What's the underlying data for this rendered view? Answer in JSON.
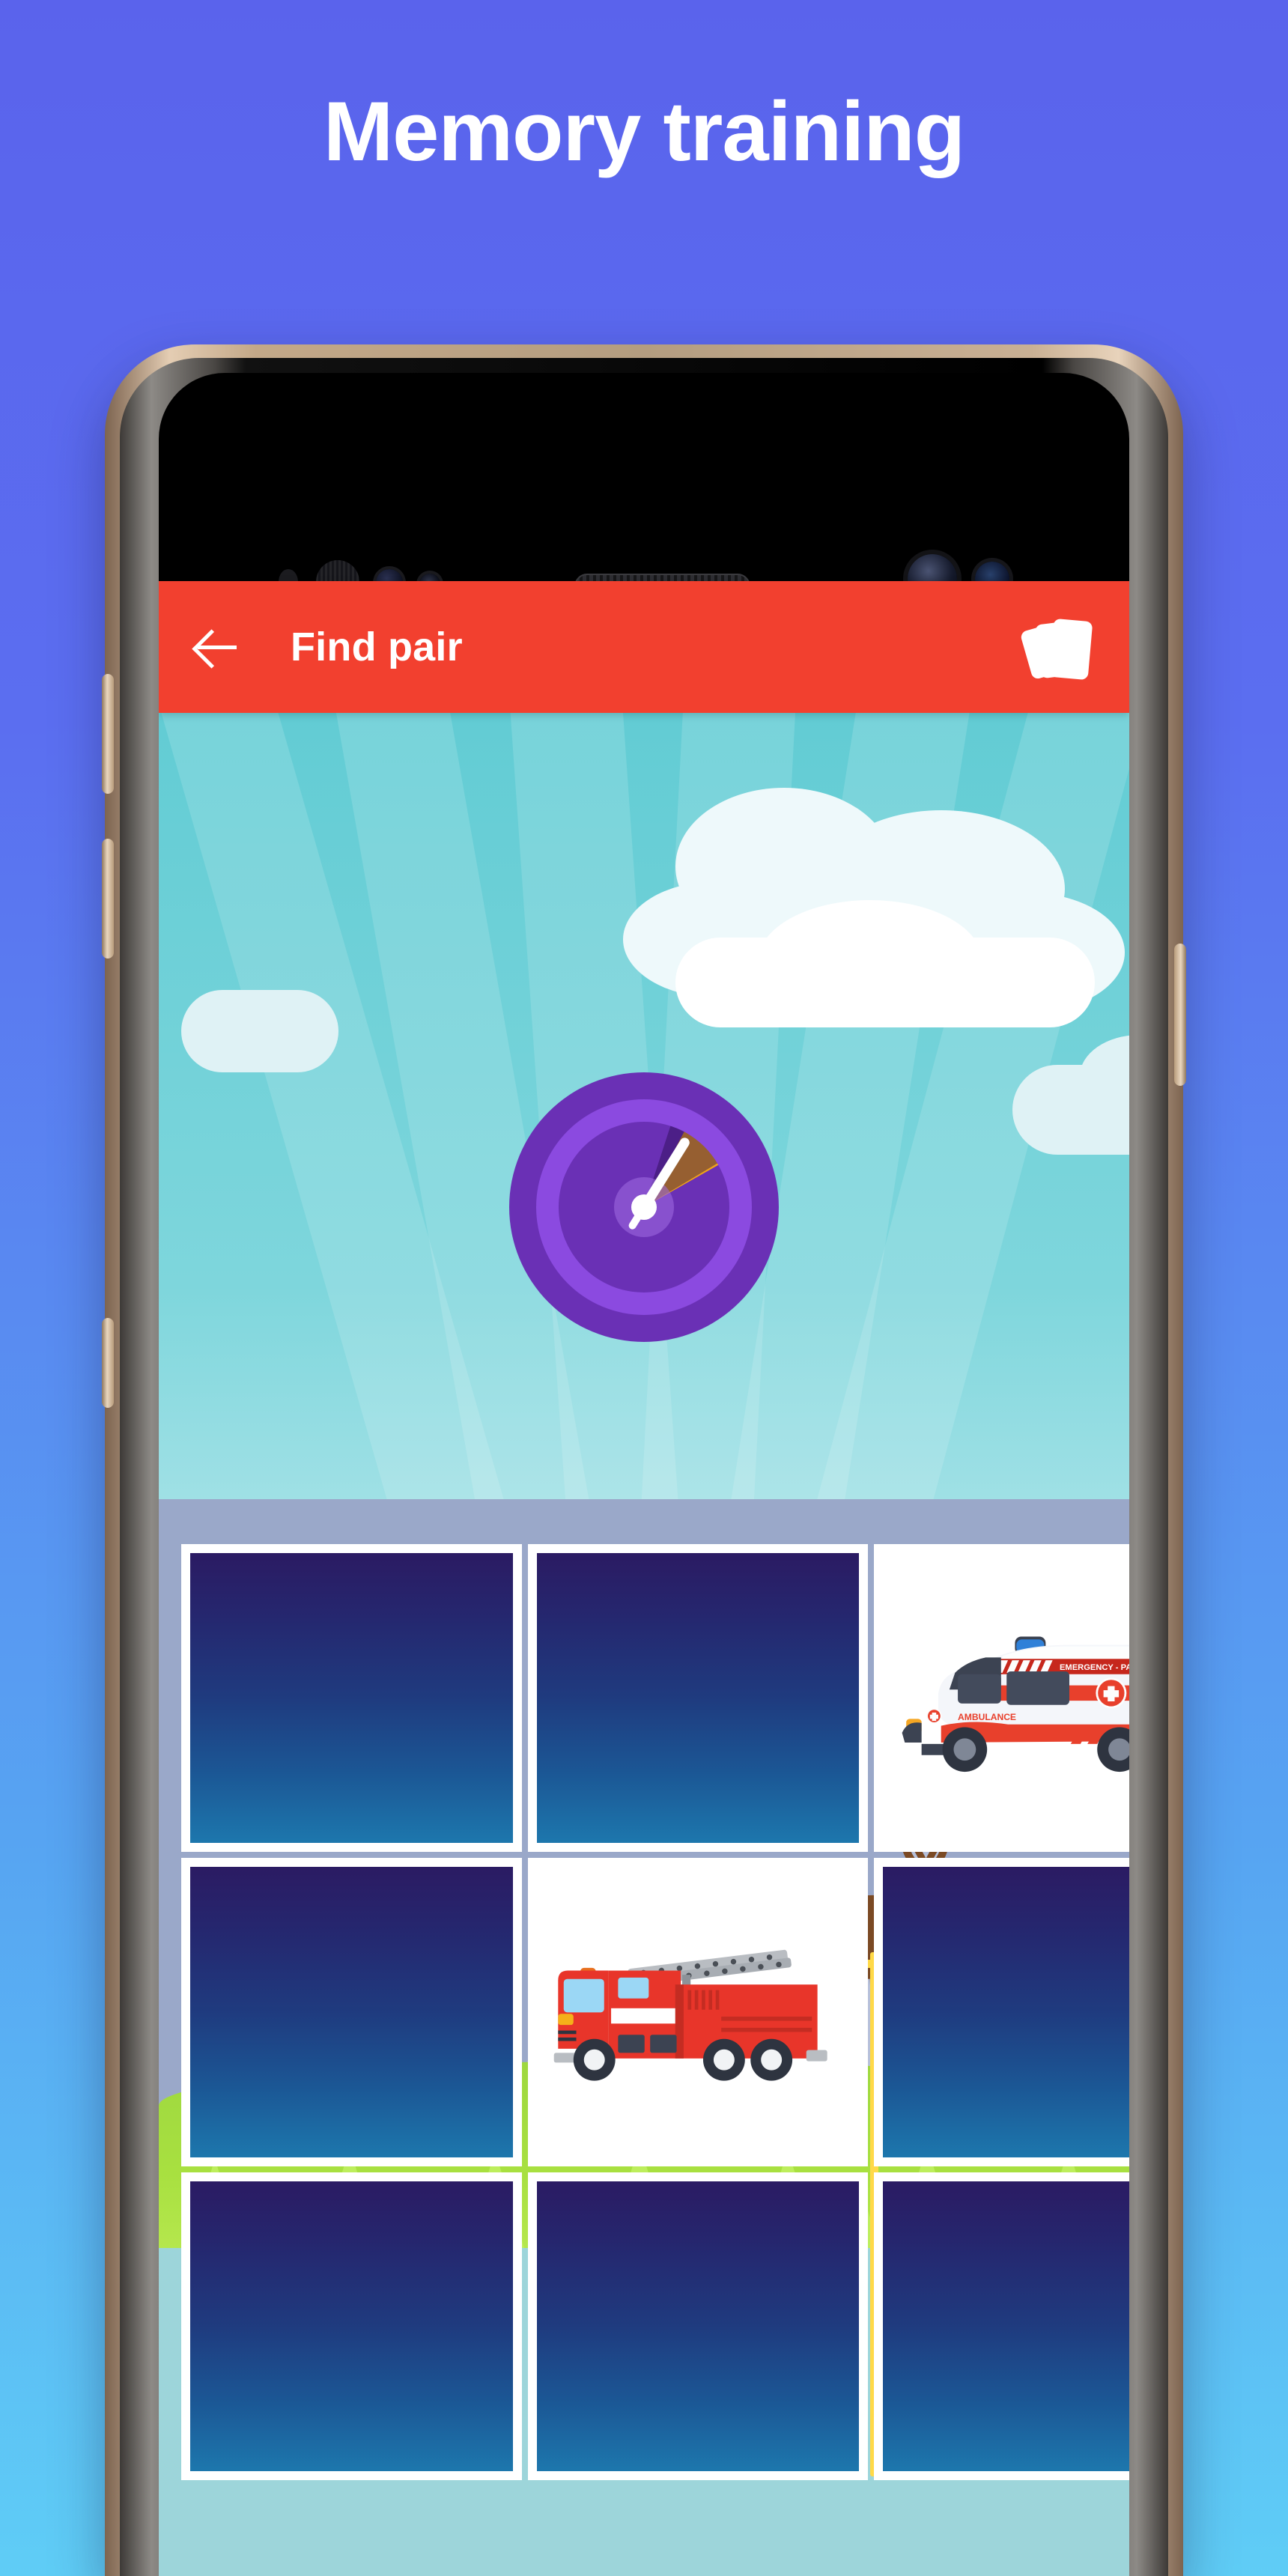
{
  "promo": {
    "title": "Memory training",
    "background_top": "#5a63ec",
    "background_bottom": "#5fcdf6"
  },
  "device": {
    "name": "android-phone-mockup",
    "bezel_color": "#c3a888",
    "screen_bg": "#000000",
    "hardware": {
      "earpiece": "speaker-grille",
      "front_camera": "front-camera",
      "proximity_sensor": "proximity-sensor",
      "iris_scanner": "iris-scanner",
      "volume_up": "volume-up-button",
      "volume_down": "volume-down-button",
      "bixby": "assistant-button",
      "power": "power-button"
    }
  },
  "app": {
    "appbar": {
      "back_label": "back-arrow",
      "title": "Find pair",
      "action_icon": "cards-stack-icon",
      "bg_color": "#f2402f",
      "text_color": "#ffffff"
    },
    "timer": {
      "name": "round-timer-gauge",
      "ring_color": "#8b4ae0",
      "body_color": "#6a30b5",
      "progress_color": "#f0a419",
      "needle_color": "#ffffff",
      "needle_angle_deg": 32,
      "progress_arc_deg": 28
    },
    "board": {
      "rows": 3,
      "columns": 3,
      "card_back_top": "#2b1b63",
      "card_back_bottom": "#1d77ad",
      "highlight_color": "#ffd948",
      "cells": [
        {
          "index": 0,
          "state": "face-down",
          "image": ""
        },
        {
          "index": 1,
          "state": "face-down",
          "image": ""
        },
        {
          "index": 2,
          "state": "face-up",
          "image": "ambulance"
        },
        {
          "index": 3,
          "state": "face-down",
          "image": ""
        },
        {
          "index": 4,
          "state": "face-up",
          "image": "fire-truck"
        },
        {
          "index": 5,
          "state": "face-down",
          "image": ""
        },
        {
          "index": 6,
          "state": "face-down",
          "image": ""
        },
        {
          "index": 7,
          "state": "face-down",
          "image": ""
        },
        {
          "index": 8,
          "state": "face-down",
          "image": ""
        }
      ]
    },
    "artwork": {
      "ambulance": {
        "roof_text": "EMERGENCY - PARAMEDICS",
        "door_text": "AMBULANCE",
        "body_color": "#f4f6fa",
        "stripe_color": "#e8402c",
        "beacon_color": "#2f80d8"
      },
      "fire_truck": {
        "body_color": "#e8352a",
        "ladder_color": "#b9bdc2",
        "window_color": "#9bd7f5"
      },
      "scene": {
        "sky_color": "#62ccd4",
        "cloud_color": "#eef9fb",
        "mountain_color": "#aab6d4",
        "forest_color": "#4c7c2c",
        "grass_color": "#a8e040",
        "deer_color": "#7b4a24"
      }
    }
  }
}
